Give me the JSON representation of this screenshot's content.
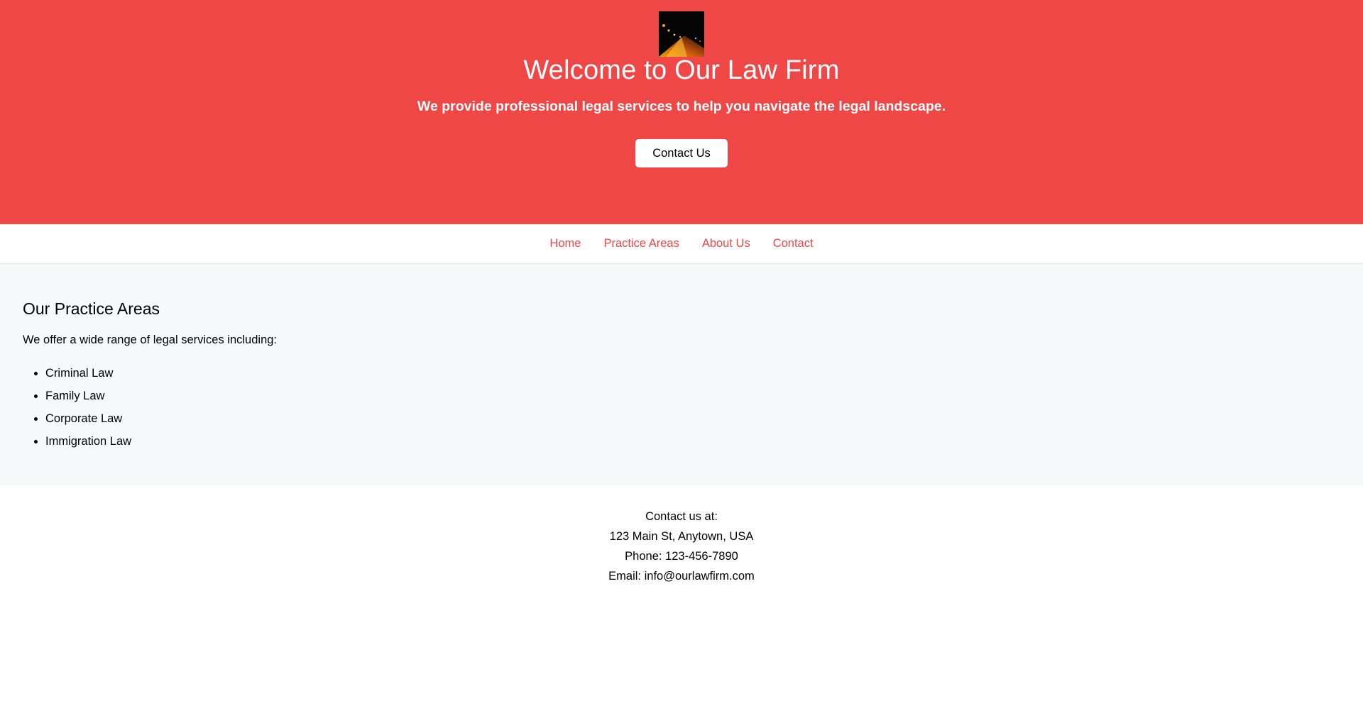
{
  "hero": {
    "logo_icon": "night-road-photo-icon",
    "title": "Welcome to Our Law Firm",
    "subtitle": "We provide professional legal services to help you navigate the legal landscape.",
    "button_label": "Contact Us",
    "background_color": "#ef4646"
  },
  "nav": {
    "items": [
      {
        "label": "Home"
      },
      {
        "label": "Practice Areas"
      },
      {
        "label": "About Us"
      },
      {
        "label": "Contact"
      }
    ],
    "link_color": "#ef4646"
  },
  "practice": {
    "title": "Our Practice Areas",
    "intro": "We offer a wide range of legal services including:",
    "areas": [
      "Criminal Law",
      "Family Law",
      "Corporate Law",
      "Immigration Law"
    ]
  },
  "footer": {
    "lines": [
      "Contact us at:",
      "123 Main St, Anytown, USA",
      "Phone: 123-456-7890",
      "Email: info@ourlawfirm.com"
    ]
  }
}
